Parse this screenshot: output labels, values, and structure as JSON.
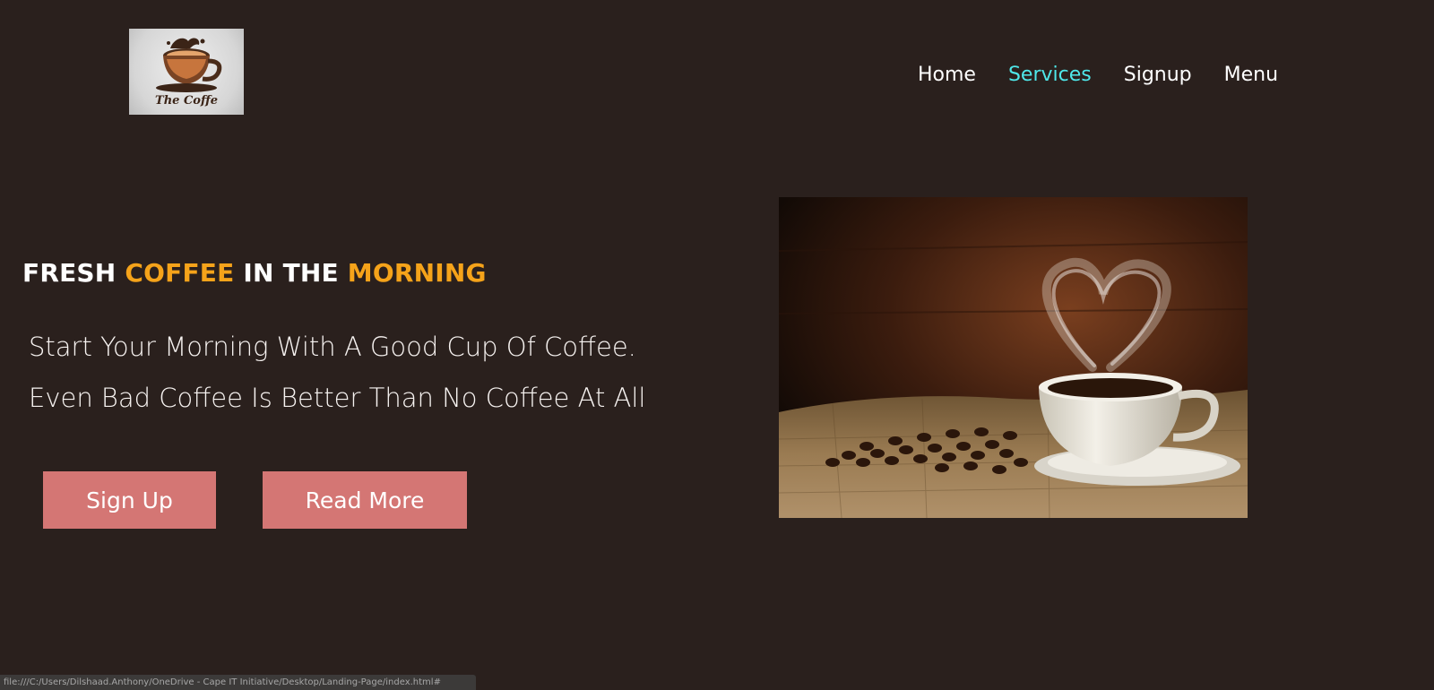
{
  "header": {
    "logo_text": "The Coffe",
    "nav": [
      {
        "label": "Home",
        "active": false
      },
      {
        "label": "Services",
        "active": true
      },
      {
        "label": "Signup",
        "active": false
      },
      {
        "label": "Menu",
        "active": false
      }
    ]
  },
  "hero": {
    "headline": {
      "part1": "FRESH ",
      "part2": "COFFEE",
      "part3": " IN THE ",
      "part4": "MORNING"
    },
    "line1": "Start Your Morning With A Good Cup Of Coffee.",
    "line2": "Even Bad Coffee Is Better Than No Coffee At All",
    "buttons": {
      "signup": "Sign Up",
      "read_more": "Read More"
    }
  },
  "status_bar": {
    "url": "file:///C:/Users/Dilshaad.Anthony/OneDrive - Cape IT Initiative/Desktop/Landing-Page/index.html#"
  },
  "colors": {
    "background": "#2a201d",
    "accent_orange": "#f5a31a",
    "nav_active": "#4fe8ea",
    "button": "#d47674"
  },
  "icons": {
    "logo": "coffee-cup-logo",
    "hero": "coffee-cup-heart-steam-photo"
  }
}
